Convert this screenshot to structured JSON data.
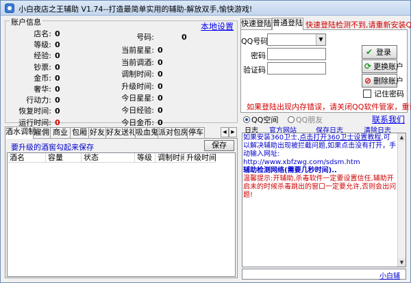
{
  "window": {
    "title": "小白夜店之王辅助 V1.74--打造最简单实用的辅助-解放双手,愉快游戏!",
    "minimize": "–",
    "maximize": "□",
    "close": "✕"
  },
  "account": {
    "group_title": "账户信息",
    "settings_link": "本地设置",
    "left": [
      {
        "label": "店名:",
        "value": "0",
        "red": false
      },
      {
        "label": "等级:",
        "value": "0",
        "red": false
      },
      {
        "label": "经验:",
        "value": "0",
        "red": false
      },
      {
        "label": "钞票:",
        "value": "0",
        "red": false
      },
      {
        "label": "金币:",
        "value": "0",
        "red": false
      },
      {
        "label": "奢华:",
        "value": "0",
        "red": false
      },
      {
        "label": "行动力:",
        "value": "0",
        "red": false
      },
      {
        "label": "恢复时间:",
        "value": "0",
        "red": false
      },
      {
        "label": "运行时间:",
        "value": "0",
        "red": true
      }
    ],
    "right": [
      {
        "label": "号码:",
        "value": "0"
      },
      {
        "label": "当前星星:",
        "value": "0"
      },
      {
        "label": "当前调酒:",
        "value": "0"
      },
      {
        "label": "调制时间:",
        "value": "0"
      },
      {
        "label": "升级时间:",
        "value": "0"
      },
      {
        "label": "今日星星:",
        "value": "0"
      },
      {
        "label": "今日经验:",
        "value": "0"
      },
      {
        "label": "今日金币:",
        "value": "0"
      }
    ]
  },
  "tabs": [
    "酒水调制",
    "雇佣",
    "商业",
    "包厢",
    "好友",
    "好友送礼",
    "吸血鬼",
    "派对包房",
    "停车"
  ],
  "tab_panel": {
    "hint": "要升级的酒窖勾起来保存",
    "save_label": "保存",
    "columns": [
      "酒名",
      "容量",
      "状态",
      "等级",
      "调制时间",
      "升级时间"
    ]
  },
  "login": {
    "tabs": [
      "快速登陆",
      "普通登陆"
    ],
    "note": "快速登陆检测不到,请重新安装QQ",
    "qq_label": "QQ号码",
    "password_label": "密码",
    "captcha_label": "验证码",
    "login_btn": "登录",
    "switch_btn": "更换账户",
    "delete_btn": "删除账户",
    "remember": "记住密码",
    "warning": "如果登陆出现内存错误，请关闭QQ软件管家，重试."
  },
  "qq": {
    "opt1": "QQ空间",
    "opt2": "QQ朋友",
    "contact": "联系我们"
  },
  "log": {
    "label": "日志",
    "official": "官方网站",
    "save": "保存日志",
    "clear": "清除日志",
    "line1a": "如果安装360卫士,",
    "line1b": "点击打开360卫士设置教程",
    "line1c": ",可以解决辅助出现被拦截问题,如果点击没有打开，手动输入网址:",
    "url": "http://www.xbfzwg.com/sdsm.htm",
    "detect": "辅助检测网络(需要几秒时间)..",
    "tip": "温馨提示:开辅助,杀毒软件一定要设置信任,辅助开启未的时候杀毒跳出的窗口一定要允许,否则会出问题!",
    "footer": "小白辅"
  }
}
